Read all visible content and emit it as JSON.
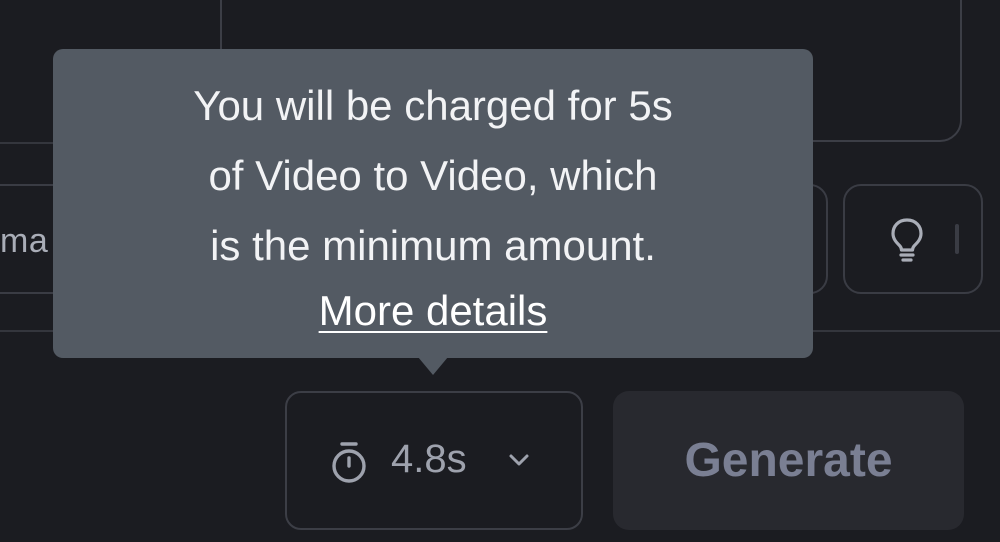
{
  "chip_left": {
    "label_fragment": "ma"
  },
  "tooltip": {
    "lines": [
      "You will be charged for 5s",
      "of Video to Video, which",
      "is the minimum amount."
    ],
    "link_label": "More details"
  },
  "duration_select": {
    "value": "4.8s",
    "icon": "timer-icon"
  },
  "generate_button": {
    "label": "Generate"
  },
  "hint_button": {
    "icon": "lightbulb-icon"
  },
  "colors": {
    "background": "#1b1c21",
    "tooltip_bg": "#535a63",
    "generate_bg": "#28292f",
    "generate_text": "#7a7f93"
  }
}
